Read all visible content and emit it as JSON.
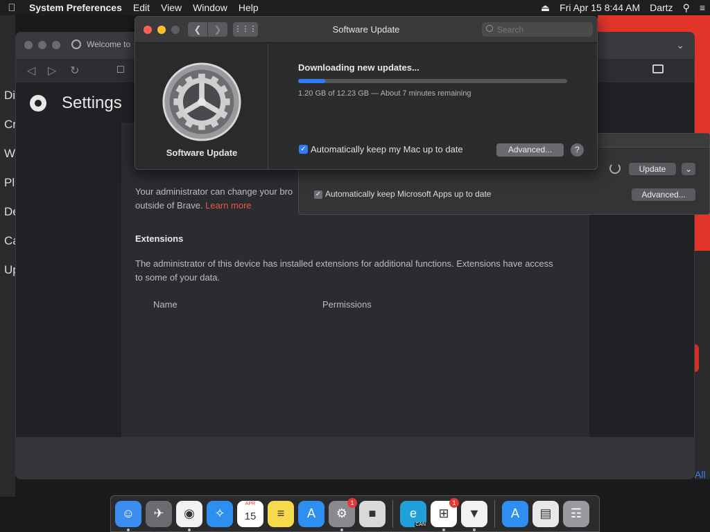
{
  "menubar": {
    "app_name": "System Preferences",
    "menus": [
      "Edit",
      "View",
      "Window",
      "Help"
    ],
    "date_time": "Fri Apr 15  8:44 AM",
    "user": "Dartz"
  },
  "left_window": {
    "items": [
      "Di",
      "Cr",
      "W",
      "Pl",
      "De",
      "Ca",
      "Up"
    ]
  },
  "brave": {
    "tab_title": "Welcome to",
    "page_title": "Settings",
    "admin_text_line1": "Your administrator can change your bro",
    "admin_text_line2": "outside of Brave. ",
    "learn_more": "Learn more",
    "extensions_heading": "Extensions",
    "extensions_text_line1": "The administrator of this device has installed extensions for additional functions. Extensions have access",
    "extensions_text_line2": "to some of your data.",
    "col_name": "Name",
    "col_permissions": "Permissions",
    "right_edge_link": "All"
  },
  "microsoft_autoupdate": {
    "update_button": "Update",
    "auto_checkbox_label": "Automatically keep Microsoft Apps up to date",
    "auto_checked": true,
    "advanced_button": "Advanced..."
  },
  "software_update": {
    "window_title": "Software Update",
    "search_placeholder": "Search",
    "pane_label": "Software Update",
    "downloading_title": "Downloading new updates...",
    "progress_fraction": 0.1,
    "progress_text": "1.20 GB of 12.23 GB — About 7 minutes remaining",
    "auto_checkbox_label": "Automatically keep my Mac up to date",
    "auto_checked": true,
    "advanced_button": "Advanced...",
    "help_button": "?"
  },
  "dock": {
    "apps": [
      {
        "name": "finder-icon",
        "color": "#3b8ef0",
        "glyph": "☺"
      },
      {
        "name": "launchpad-icon",
        "color": "#6b6b70",
        "glyph": "✈"
      },
      {
        "name": "chrome-icon",
        "color": "#f2f2f2",
        "glyph": "◉"
      },
      {
        "name": "safari-icon",
        "color": "#2f8ff0",
        "glyph": "✧"
      },
      {
        "name": "calendar-icon",
        "color": "#ffffff",
        "glyph": "15",
        "month": "APR"
      },
      {
        "name": "notes-icon",
        "color": "#f7d94c",
        "glyph": "≡"
      },
      {
        "name": "app-store-icon",
        "color": "#2f8ff0",
        "glyph": "A"
      },
      {
        "name": "system-preferences-icon",
        "color": "#8a8a8e",
        "glyph": "⚙",
        "badge": "1"
      },
      {
        "name": "roblox-icon",
        "color": "#d9d9d9",
        "glyph": "■"
      },
      {
        "name": "edge-canary-icon",
        "color": "#1fa0d8",
        "glyph": "e",
        "sublabel": "CAN"
      },
      {
        "name": "microsoft-autoupdate-icon",
        "color": "#ffffff",
        "glyph": "⊞",
        "badge": "1"
      },
      {
        "name": "brave-icon",
        "color": "#f2f2f2",
        "glyph": "▼"
      },
      {
        "name": "app-store-download-icon",
        "color": "#2f8ff0",
        "glyph": "A"
      },
      {
        "name": "downloads-stack-icon",
        "color": "#e8e8e8",
        "glyph": "▤"
      },
      {
        "name": "trash-icon",
        "color": "#9a9a9e",
        "glyph": "☶"
      }
    ]
  }
}
